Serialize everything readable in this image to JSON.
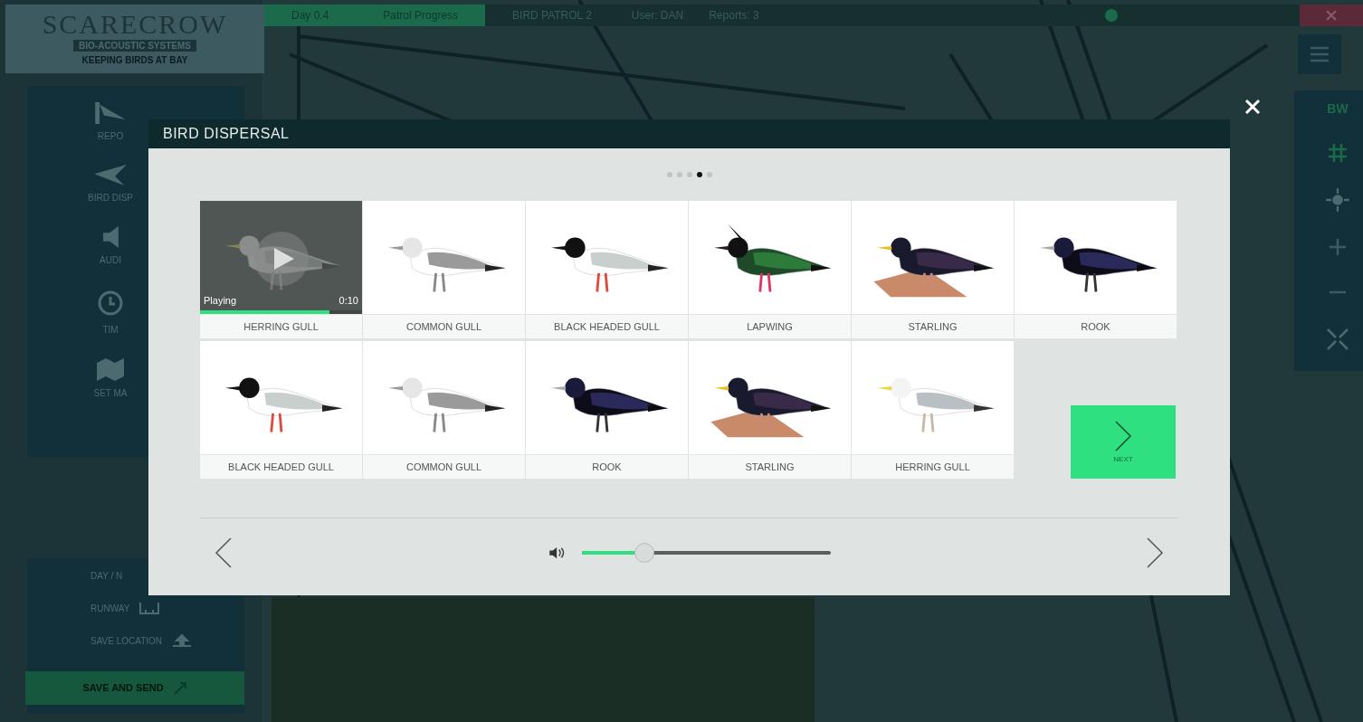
{
  "logo": {
    "title": "SCARECROW",
    "subtitle": "BIO-ACOUSTIC SYSTEMS",
    "tagline": "KEEPING BIRDS AT BAY"
  },
  "top_bar": {
    "tabs": [
      {
        "label": "Day 0.4",
        "selected": true
      },
      {
        "label": "Patrol Progress",
        "selected": true
      },
      {
        "label": "BIRD PATROL 2",
        "selected": false
      }
    ],
    "info": [
      "User: DAN",
      "Reports: 3"
    ]
  },
  "sidebar": {
    "items": [
      {
        "label": "REPO",
        "kind": "report"
      },
      {
        "label": "BIRD DISP",
        "kind": "bird"
      },
      {
        "label": "AUDI",
        "kind": "audio"
      },
      {
        "label": "TIM",
        "kind": "timer"
      },
      {
        "label": "SET MA",
        "kind": "map"
      }
    ],
    "bottom": [
      {
        "label": "DAY / N",
        "kind": "plain"
      },
      {
        "label": "RUNWAY",
        "kind": "runway"
      },
      {
        "label": "SAVE LOCATION",
        "kind": "save"
      }
    ],
    "save_send": "SAVE AND SEND"
  },
  "map_tools": {
    "mode": "BW"
  },
  "dialog": {
    "title": "BIRD DISPERSAL",
    "pages": [
      {
        "selected": false
      },
      {
        "selected": false
      },
      {
        "selected": false
      },
      {
        "selected": true
      },
      {
        "selected": false
      }
    ],
    "birds": [
      {
        "name": "HERRING GULL",
        "kind": "herring",
        "playing": true,
        "status": "Playing",
        "time": "0:10",
        "level": 0.8
      },
      {
        "name": "COMMON GULL",
        "kind": "common",
        "playing": false
      },
      {
        "name": "BLACK HEADED GULL",
        "kind": "blackhead",
        "playing": false
      },
      {
        "name": "LAPWING",
        "kind": "lapwing",
        "playing": false
      },
      {
        "name": "STARLING",
        "kind": "starling",
        "playing": false
      },
      {
        "name": "ROOK",
        "kind": "rook",
        "playing": false
      },
      {
        "name": "BLACK HEADED GULL",
        "kind": "blackhead",
        "playing": false
      },
      {
        "name": "COMMON GULL",
        "kind": "common",
        "playing": false
      },
      {
        "name": "ROOK",
        "kind": "rook",
        "playing": false
      },
      {
        "name": "STARLING",
        "kind": "starling",
        "playing": false
      },
      {
        "name": "HERRING GULL",
        "kind": "herring",
        "playing": false
      }
    ],
    "next": "NEXT",
    "volume": {
      "level": 0.23
    }
  }
}
